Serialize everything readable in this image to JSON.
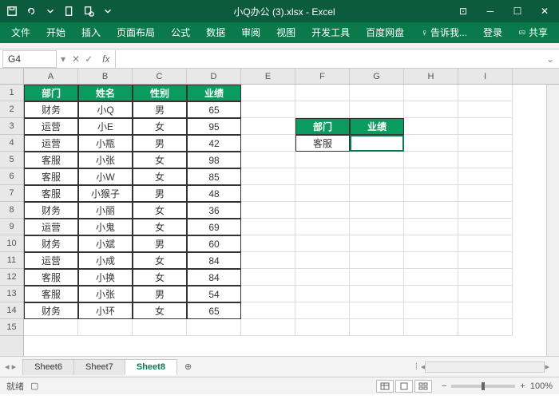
{
  "title": "小Q办公 (3).xlsx - Excel",
  "ribbon": {
    "file": "文件",
    "tabs": [
      "开始",
      "插入",
      "页面布局",
      "公式",
      "数据",
      "审阅",
      "视图",
      "开发工具",
      "百度网盘"
    ],
    "tell": "告诉我...",
    "login": "登录",
    "share": "共享"
  },
  "namebox": "G4",
  "cols": [
    "A",
    "B",
    "C",
    "D",
    "E",
    "F",
    "G",
    "H",
    "I"
  ],
  "rows": 15,
  "table": {
    "headers": [
      "部门",
      "姓名",
      "性别",
      "业绩"
    ],
    "data": [
      [
        "财务",
        "小Q",
        "男",
        "65"
      ],
      [
        "运营",
        "小E",
        "女",
        "95"
      ],
      [
        "运营",
        "小瓶",
        "男",
        "42"
      ],
      [
        "客服",
        "小张",
        "女",
        "98"
      ],
      [
        "客服",
        "小W",
        "女",
        "85"
      ],
      [
        "客服",
        "小猴子",
        "男",
        "48"
      ],
      [
        "财务",
        "小丽",
        "女",
        "36"
      ],
      [
        "运营",
        "小鬼",
        "女",
        "69"
      ],
      [
        "财务",
        "小斌",
        "男",
        "60"
      ],
      [
        "运营",
        "小成",
        "女",
        "84"
      ],
      [
        "客服",
        "小换",
        "女",
        "84"
      ],
      [
        "客服",
        "小张",
        "男",
        "54"
      ],
      [
        "财务",
        "小环",
        "女",
        "65"
      ]
    ]
  },
  "side": {
    "headers": [
      "部门",
      "业绩"
    ],
    "row": [
      "客服",
      ""
    ]
  },
  "sheets": [
    "Sheet6",
    "Sheet7",
    "Sheet8"
  ],
  "activeSheet": 2,
  "status": "就绪",
  "zoom": "100%",
  "selectedCell": "G4"
}
